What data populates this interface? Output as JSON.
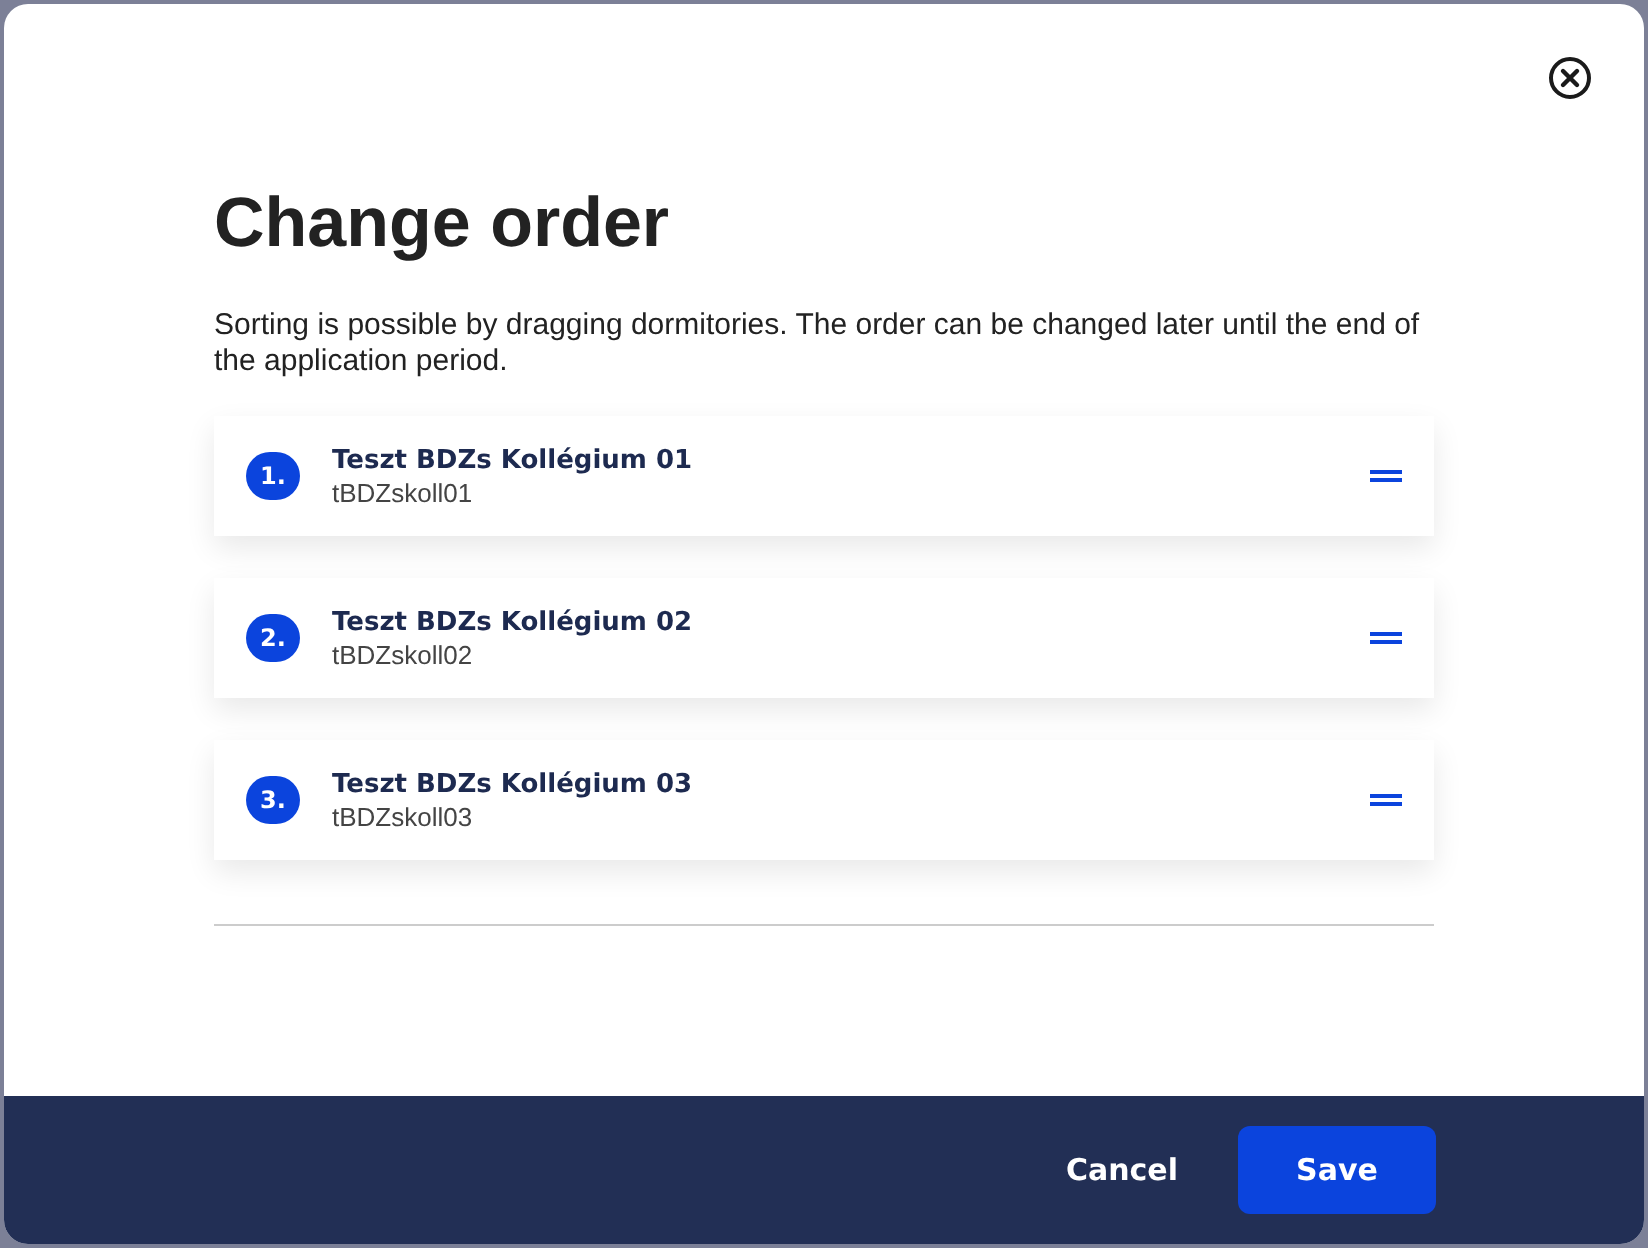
{
  "dialog": {
    "title": "Change order",
    "description": "Sorting is possible by dragging dormitories. The order can be changed later until the end of the application period."
  },
  "items": [
    {
      "number": "1.",
      "name": "Teszt BDZs Kollégium 01",
      "code": "tBDZskoll01"
    },
    {
      "number": "2.",
      "name": "Teszt BDZs Kollégium 02",
      "code": "tBDZskoll02"
    },
    {
      "number": "3.",
      "name": "Teszt BDZs Kollégium 03",
      "code": "tBDZskoll03"
    }
  ],
  "buttons": {
    "cancel": "Cancel",
    "save": "Save"
  }
}
